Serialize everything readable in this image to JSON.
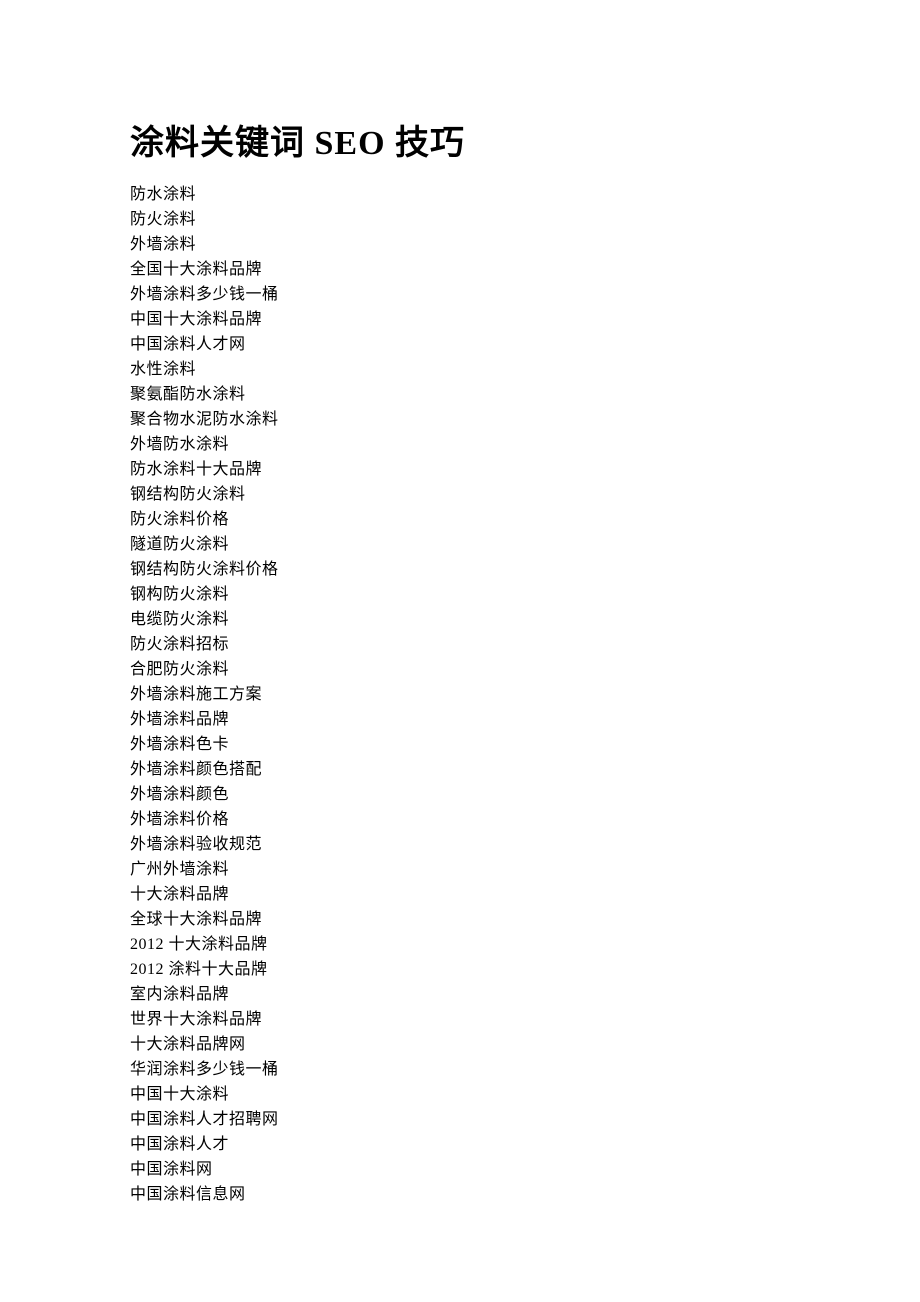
{
  "title": "涂料关键词 SEO 技巧",
  "keywords": [
    "防水涂料",
    "防火涂料",
    "外墙涂料",
    "全国十大涂料品牌",
    "外墙涂料多少钱一桶",
    "中国十大涂料品牌",
    "中国涂料人才网",
    "水性涂料",
    "聚氨酯防水涂料",
    "聚合物水泥防水涂料",
    "外墙防水涂料",
    "防水涂料十大品牌",
    "钢结构防火涂料",
    "防火涂料价格",
    "隧道防火涂料",
    "钢结构防火涂料价格",
    "钢构防火涂料",
    "电缆防火涂料",
    "防火涂料招标",
    "合肥防火涂料",
    "外墙涂料施工方案",
    "外墙涂料品牌",
    "外墙涂料色卡",
    "外墙涂料颜色搭配",
    "外墙涂料颜色",
    "外墙涂料价格",
    "外墙涂料验收规范",
    "广州外墙涂料",
    "十大涂料品牌",
    "全球十大涂料品牌",
    "2012 十大涂料品牌",
    "2012 涂料十大品牌",
    "室内涂料品牌",
    "世界十大涂料品牌",
    "十大涂料品牌网",
    "华润涂料多少钱一桶",
    "中国十大涂料",
    "中国涂料人才招聘网",
    "中国涂料人才",
    "中国涂料网",
    "中国涂料信息网"
  ]
}
